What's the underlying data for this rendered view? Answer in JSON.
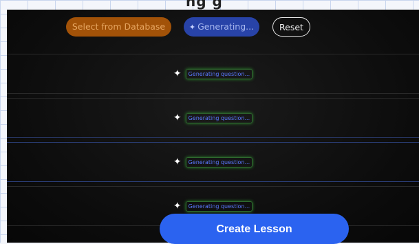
{
  "header_text": "ng g",
  "toolbar": {
    "select_db_label": "Select from Database",
    "generating_label": "Generating...",
    "generating_icon": "sparkle-icon",
    "reset_label": "Reset"
  },
  "rows": [
    {
      "status": "Generating question...",
      "icon": "sparkle-icon"
    },
    {
      "status": "Generating question...",
      "icon": "sparkle-icon"
    },
    {
      "status": "Generating question...",
      "icon": "sparkle-icon"
    },
    {
      "status": "Generating question...",
      "icon": "sparkle-icon"
    }
  ],
  "create_label": "Create Lesson",
  "colors": {
    "db_pill": "#a25208",
    "generating_pill": "#2843a8",
    "create_button": "#2b63f0",
    "status_text": "#5a78ff",
    "glow": "#2e8a2e"
  }
}
